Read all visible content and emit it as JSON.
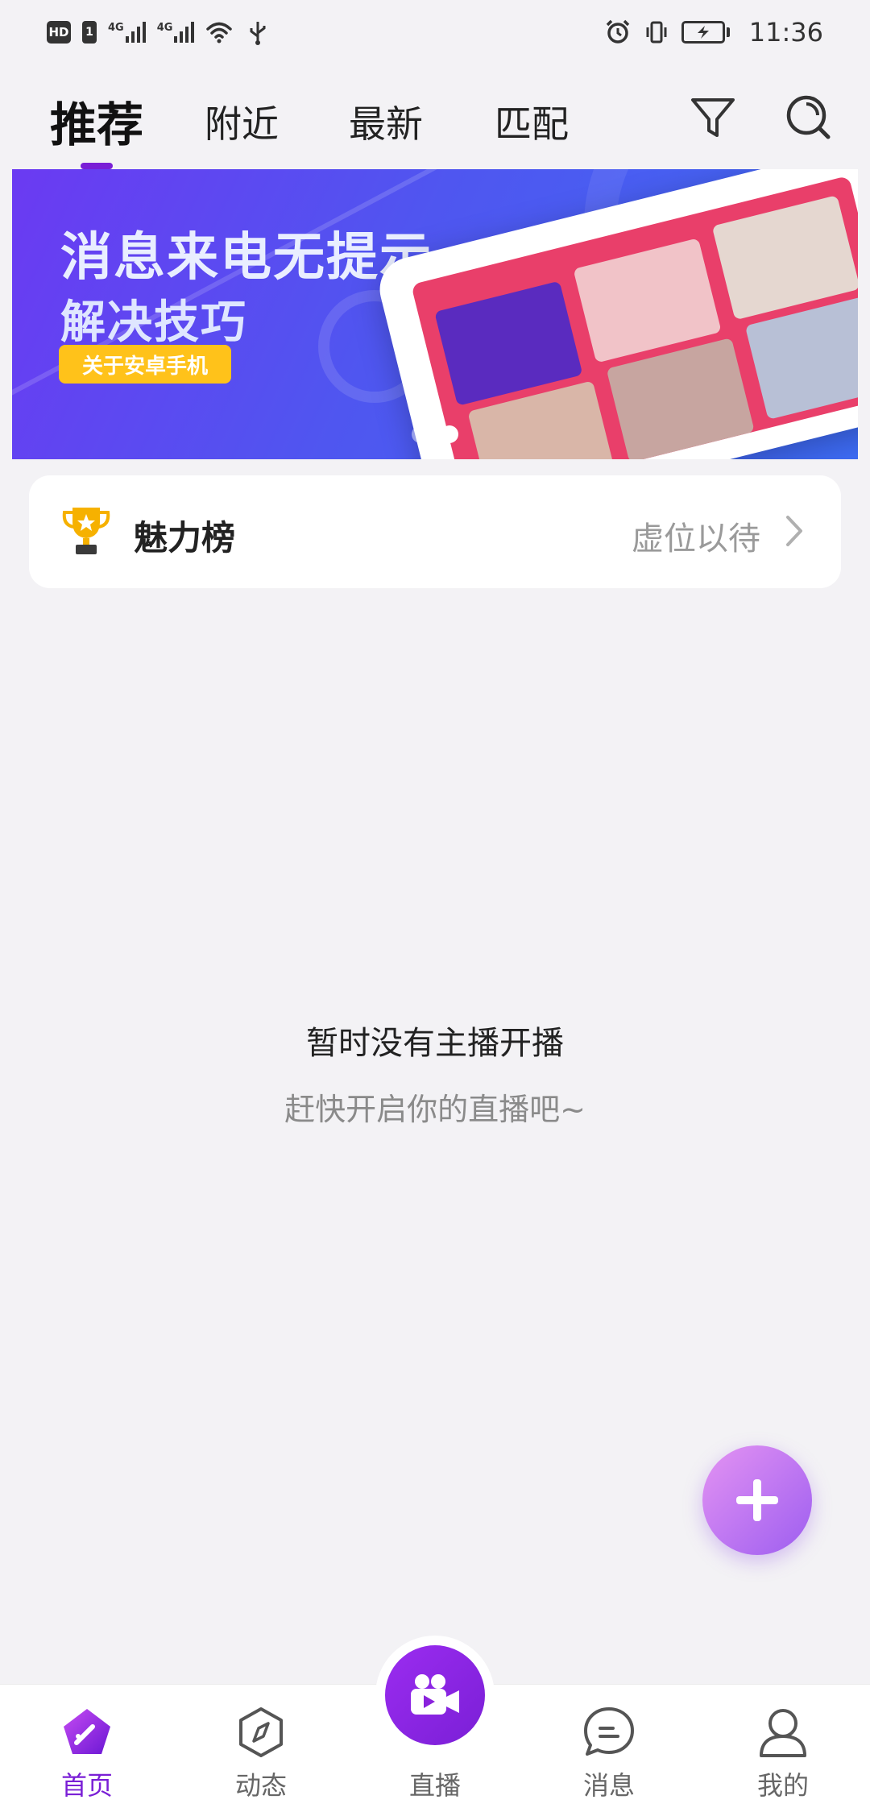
{
  "status_bar": {
    "hd": "HD",
    "sim": "1",
    "net1": "4G",
    "net2": "4G",
    "time": "11:36"
  },
  "tabs": [
    {
      "label": "推荐",
      "active": true
    },
    {
      "label": "附近",
      "active": false
    },
    {
      "label": "最新",
      "active": false
    },
    {
      "label": "匹配",
      "active": false
    }
  ],
  "toolbar": {
    "filter_icon": "filter-icon",
    "search_icon": "search-icon"
  },
  "banner": {
    "title": "消息来电无提示",
    "subtitle": "解决技巧",
    "button_label": "关于安卓手机",
    "page_count": 2,
    "active_page": 2
  },
  "charm": {
    "title": "魅力榜",
    "status": "虚位以待",
    "icon": "trophy-icon"
  },
  "empty_state": {
    "title": "暂时没有主播开播",
    "subtitle": "赶快开启你的直播吧~"
  },
  "fab": {
    "icon": "plus-icon"
  },
  "bottom_nav": [
    {
      "label": "首页",
      "icon": "home-icon",
      "active": true
    },
    {
      "label": "动态",
      "icon": "compass-icon",
      "active": false
    },
    {
      "label": "直播",
      "icon": "video-camera-icon",
      "active": false
    },
    {
      "label": "消息",
      "icon": "chat-bubble-icon",
      "active": false
    },
    {
      "label": "我的",
      "icon": "profile-icon",
      "active": false
    }
  ],
  "colors": {
    "accent": "#7a1fd6",
    "banner_start": "#6b3af2",
    "banner_end": "#3d6cf5",
    "banner_button": "#ffc21a",
    "fab_start": "#e493f3",
    "fab_end": "#9d5ef0",
    "background": "#f3f2f5"
  }
}
